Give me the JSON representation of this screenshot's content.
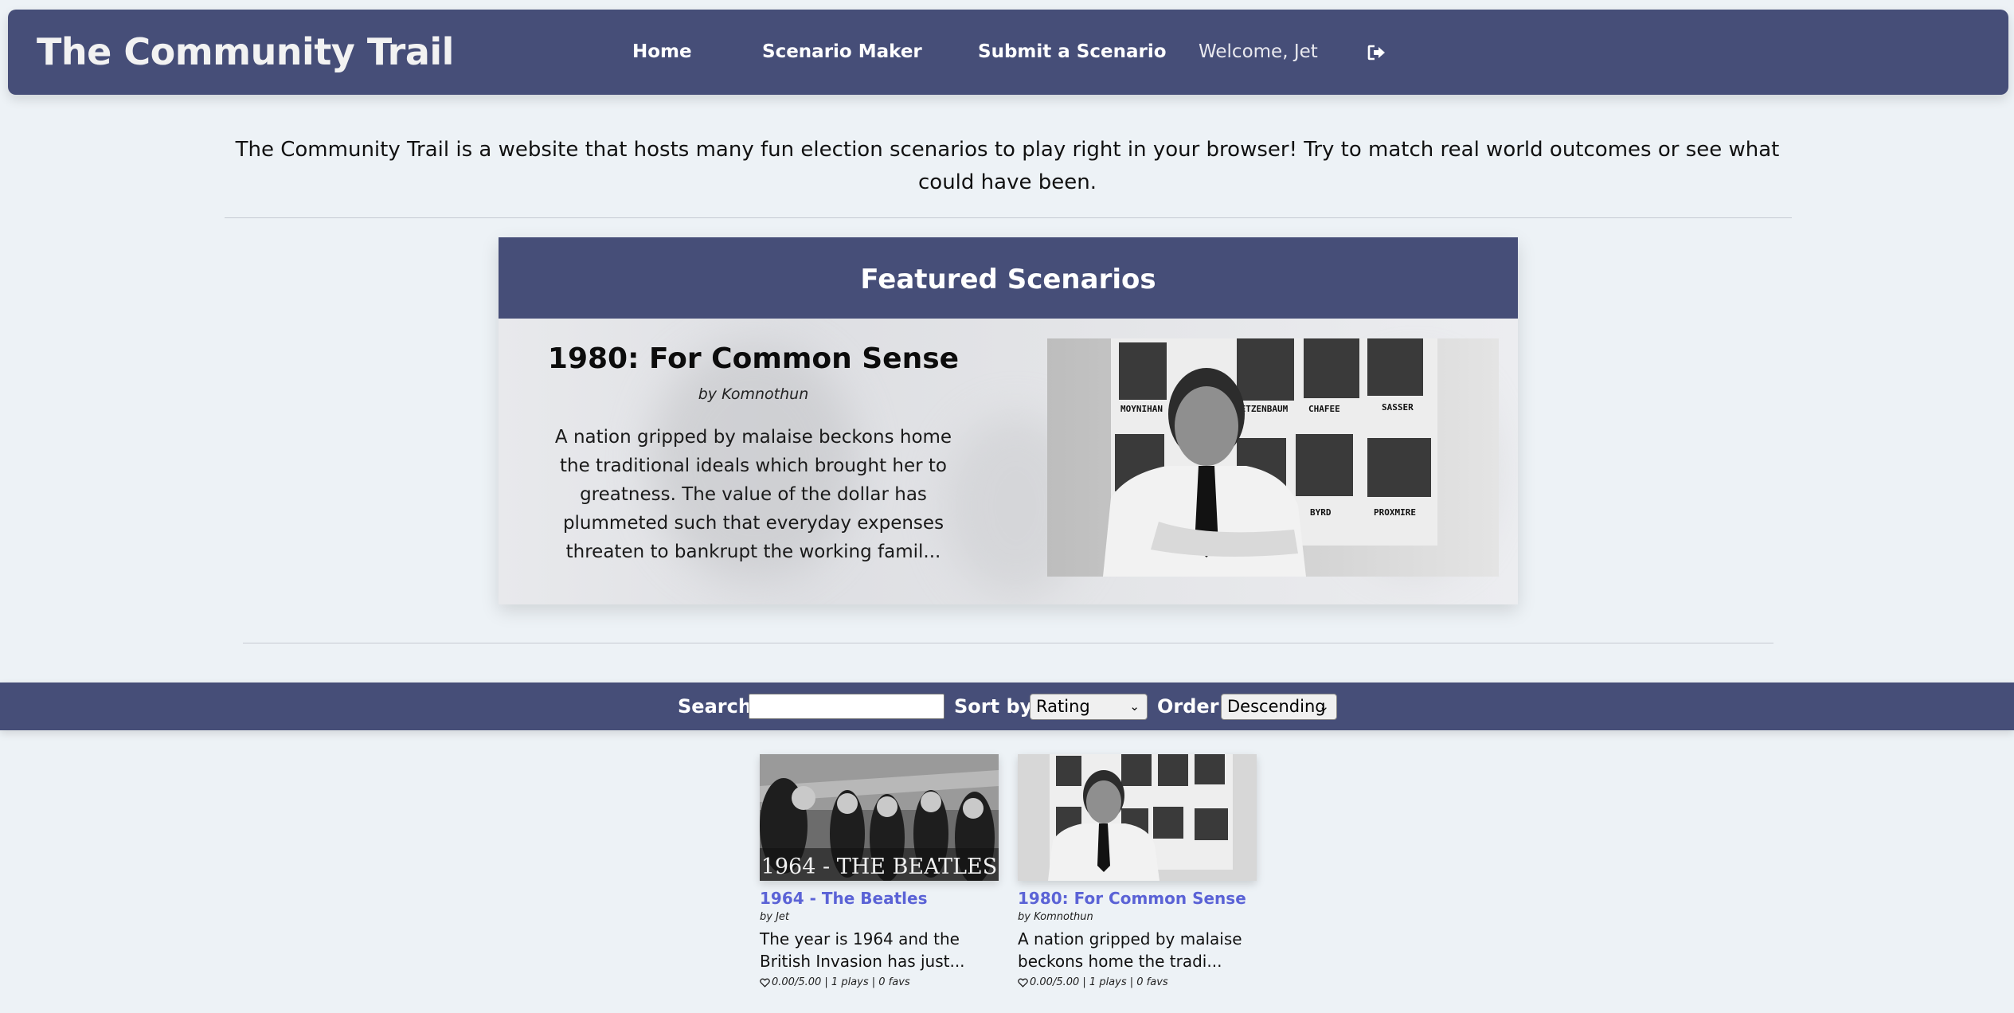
{
  "header": {
    "brand": "The Community Trail",
    "nav": [
      "Home",
      "Scenario Maker",
      "Submit a Scenario"
    ],
    "welcome": "Welcome, Jet",
    "logout_icon": "sign-out-icon"
  },
  "intro": {
    "text": "The Community Trail is a website that hosts many fun election scenarios to play right in your browser! Try to match real world outcomes or see what could have been."
  },
  "featured": {
    "heading": "Featured Scenarios",
    "title": "1980: For Common Sense",
    "author": "by Komnothun",
    "description": "A nation gripped by malaise beckons home the traditional ideals which brought her to greatness. The value of the dollar has plummeted such that everyday expenses threaten to bankrupt the working famil...",
    "image_labels": [
      "MOYNIHAN",
      "METZENBAUM",
      "CHAFEE",
      "SASSER",
      "BYRD",
      "PROXMIRE"
    ]
  },
  "search": {
    "search_label": "Search:",
    "search_value": "",
    "sort_label": "Sort by:",
    "sort_value": "Rating",
    "order_label": "Order:",
    "order_value": "Descending"
  },
  "cards": [
    {
      "title": "1964 - The Beatles",
      "author": "by Jet",
      "description": "The year is 1964 and the British Invasion has just...",
      "stats": "0.00/5.00 | 1 plays | 0 favs",
      "image_caption": "1964 - THE BEATLES"
    },
    {
      "title": "1980: For Common Sense",
      "author": "by Komnothun",
      "description": "A nation gripped by malaise beckons home the tradi...",
      "stats": "0.00/5.00 | 1 plays | 0 favs",
      "image_caption": ""
    }
  ],
  "colors": {
    "nav_bg": "#464e78",
    "page_bg": "#edf2f6",
    "link": "#5b63d6"
  }
}
